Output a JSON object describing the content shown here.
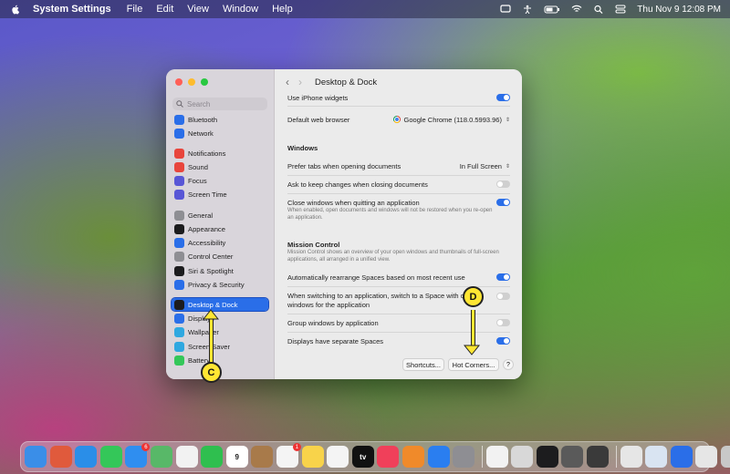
{
  "menubar": {
    "app": "System Settings",
    "items": [
      "File",
      "Edit",
      "View",
      "Window",
      "Help"
    ],
    "clock": "Thu Nov 9  12:08 PM"
  },
  "window": {
    "title": "Desktop & Dock",
    "search_placeholder": "Search",
    "sidebar": [
      {
        "label": "Bluetooth",
        "icon": "bluetooth-icon",
        "color": "#2a6ee8"
      },
      {
        "label": "Network",
        "icon": "network-icon",
        "color": "#2a6ee8"
      },
      {
        "label": "Notifications",
        "icon": "notifications-icon",
        "color": "#e8453c"
      },
      {
        "label": "Sound",
        "icon": "sound-icon",
        "color": "#e8453c"
      },
      {
        "label": "Focus",
        "icon": "focus-icon",
        "color": "#5856d6"
      },
      {
        "label": "Screen Time",
        "icon": "screen-time-icon",
        "color": "#5856d6"
      },
      {
        "label": "General",
        "icon": "general-icon",
        "color": "#8e8e93"
      },
      {
        "label": "Appearance",
        "icon": "appearance-icon",
        "color": "#1c1c1e"
      },
      {
        "label": "Accessibility",
        "icon": "accessibility-icon",
        "color": "#2a6ee8"
      },
      {
        "label": "Control Center",
        "icon": "control-center-icon",
        "color": "#8e8e93"
      },
      {
        "label": "Siri & Spotlight",
        "icon": "siri-icon",
        "color": "#1c1c1e"
      },
      {
        "label": "Privacy & Security",
        "icon": "privacy-icon",
        "color": "#2a6ee8"
      },
      {
        "label": "Desktop & Dock",
        "icon": "desktop-dock-icon",
        "color": "#1c1c1e",
        "selected": true
      },
      {
        "label": "Displays",
        "icon": "displays-icon",
        "color": "#2a6ee8"
      },
      {
        "label": "Wallpaper",
        "icon": "wallpaper-icon",
        "color": "#2fa8e0"
      },
      {
        "label": "Screen Saver",
        "icon": "screen-saver-icon",
        "color": "#2fa8e0"
      },
      {
        "label": "Battery",
        "icon": "battery-icon",
        "color": "#34c759"
      }
    ],
    "settings": {
      "iphone_widgets": {
        "label": "Use iPhone widgets",
        "on": true
      },
      "browser": {
        "label": "Default web browser",
        "value": "Google Chrome (118.0.5993.96)"
      },
      "windows_heading": "Windows",
      "prefer_tabs": {
        "label": "Prefer tabs when opening documents",
        "value": "In Full Screen"
      },
      "ask_keep": {
        "label": "Ask to keep changes when closing documents",
        "on": false
      },
      "close_windows": {
        "label": "Close windows when quitting an application",
        "description": "When enabled, open documents and windows will not be restored when you re-open an application.",
        "on": true
      },
      "mission_heading": "Mission Control",
      "mission_desc": "Mission Control shows an overview of your open windows and thumbnails of full-screen applications, all arranged in a unified view.",
      "auto_rearrange": {
        "label": "Automatically rearrange Spaces based on most recent use",
        "on": true
      },
      "switch_space": {
        "label_1": "When switching to an application, switch to a Space with o",
        "label_2": "windows for the application",
        "on": false
      },
      "group_windows": {
        "label": "Group windows by application",
        "on": false
      },
      "separate_spaces": {
        "label": "Displays have separate Spaces",
        "on": true
      }
    },
    "buttons": {
      "shortcuts": "Shortcuts...",
      "hot_corners": "Hot Corners...",
      "help": "?"
    }
  },
  "annotations": {
    "c": "C",
    "d": "D"
  },
  "dock": {
    "icons": [
      {
        "name": "finder-icon",
        "color": "#3a8ee8"
      },
      {
        "name": "launchpad-icon",
        "color": "#e05a3c"
      },
      {
        "name": "safari-icon",
        "color": "#2a8ee8"
      },
      {
        "name": "messages-icon",
        "color": "#34c759"
      },
      {
        "name": "mail-icon",
        "color": "#2f8ef0",
        "badge": "6"
      },
      {
        "name": "maps-icon",
        "color": "#58b868"
      },
      {
        "name": "photos-icon",
        "color": "#f2f2f2"
      },
      {
        "name": "facetime-icon",
        "color": "#2fbf4f"
      },
      {
        "name": "calendar-icon",
        "color": "#ffffff",
        "text": "9"
      },
      {
        "name": "notes-brown-icon",
        "color": "#a87a4a"
      },
      {
        "name": "reminders-icon",
        "color": "#f4f4f4",
        "badge": "1"
      },
      {
        "name": "notes-icon",
        "color": "#f8d34a"
      },
      {
        "name": "freeform-icon",
        "color": "#f4f4f4"
      },
      {
        "name": "apple-tv-icon",
        "color": "#111111",
        "text": "tv"
      },
      {
        "name": "music-icon",
        "color": "#f0405a"
      },
      {
        "name": "books-icon",
        "color": "#f08a2a"
      },
      {
        "name": "app-store-icon",
        "color": "#2a7ef0"
      },
      {
        "name": "system-settings-icon",
        "color": "#8e8e93"
      },
      {
        "name": "chrome-icon",
        "color": "#f2f2f2"
      },
      {
        "name": "preview-icon",
        "color": "#d8d8d8"
      },
      {
        "name": "activity-monitor-icon",
        "color": "#1c1c1e"
      },
      {
        "name": "screenshot-icon",
        "color": "#5a5a5a"
      },
      {
        "name": "terminal-icon",
        "color": "#3a3a3a"
      }
    ],
    "recent": [
      {
        "name": "recent-window-1-icon",
        "color": "#e6e6e6"
      },
      {
        "name": "recent-window-2-icon",
        "color": "#d9e4f2"
      },
      {
        "name": "recent-window-3-icon",
        "color": "#2a6ee8"
      },
      {
        "name": "recent-window-4-icon",
        "color": "#e6e6e6"
      },
      {
        "name": "trash-icon",
        "color": "#c8c8c8"
      }
    ]
  }
}
